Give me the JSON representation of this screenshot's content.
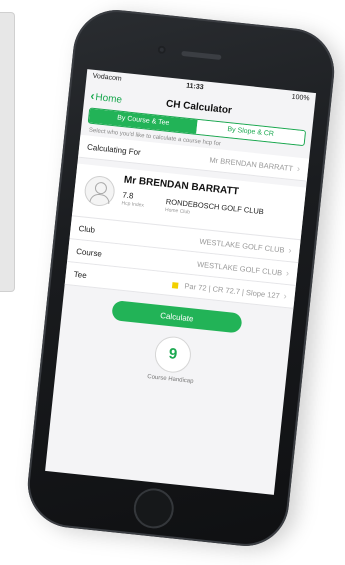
{
  "status": {
    "carrier": "Vodacom",
    "time": "11:33",
    "battery": "100%"
  },
  "nav": {
    "back_label": "Home",
    "title": "CH Calculator"
  },
  "segments": [
    {
      "label": "By Course & Tee",
      "active": true
    },
    {
      "label": "By Slope & CR",
      "active": false
    }
  ],
  "hint": "Select who you'd like to calculate a course hcp for",
  "calculating_for": {
    "label": "Calculating For",
    "value": "Mr BRENDAN BARRATT"
  },
  "profile": {
    "name": "Mr BRENDAN BARRATT",
    "handicap": "7.8",
    "handicap_label": "Hcp Index",
    "home_club": "RONDEBOSCH GOLF CLUB",
    "home_club_label": "Home Club"
  },
  "club": {
    "label": "Club",
    "value": "WESTLAKE GOLF CLUB"
  },
  "course": {
    "label": "Course",
    "value": "WESTLAKE GOLF CLUB"
  },
  "tee": {
    "label": "Tee",
    "value": "Par 72 | CR 72.7 | Slope 127",
    "color": "#f2d000"
  },
  "calculate_label": "Calculate",
  "result": {
    "value": "9",
    "label": "Course Handicap"
  },
  "accent": "#22b357"
}
